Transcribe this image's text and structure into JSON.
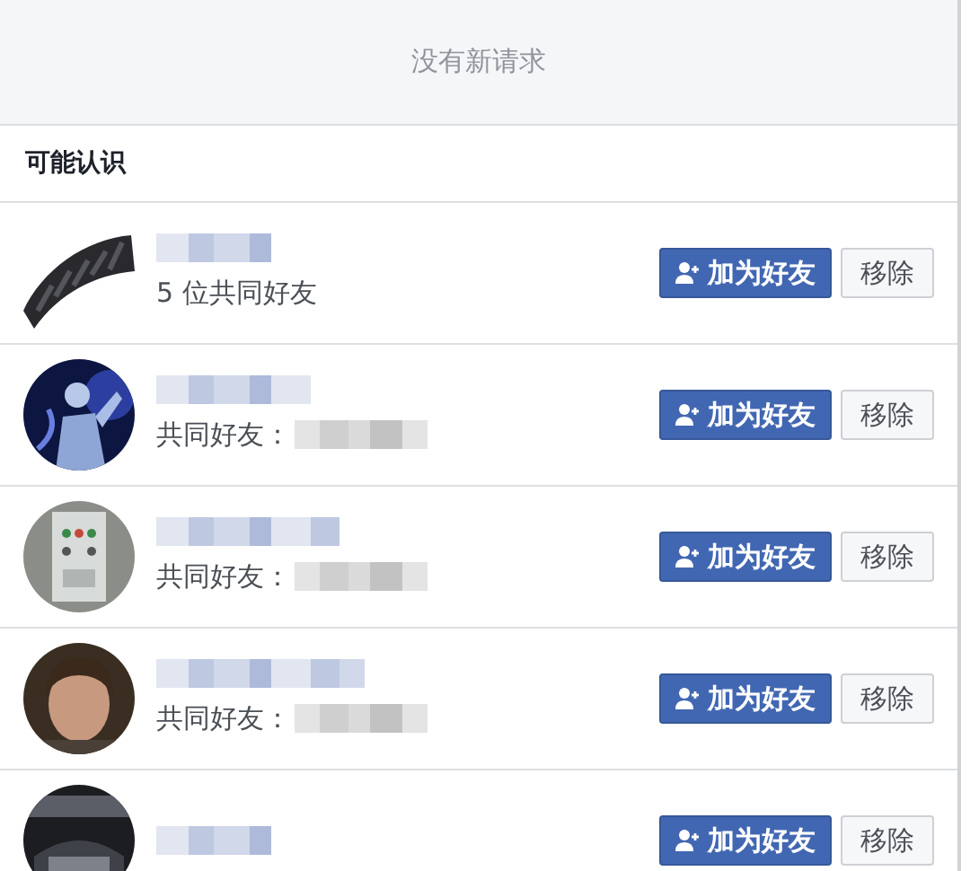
{
  "requests_notice": "没有新请求",
  "section_title": "可能认识",
  "people": [
    {
      "avatar_round": false,
      "name_redacted": true,
      "mutual_text": "5 位共同好友",
      "mutual_redacted": false,
      "add_label": "加为好友",
      "remove_label": "移除"
    },
    {
      "avatar_round": true,
      "name_redacted": true,
      "mutual_text": "共同好友：",
      "mutual_redacted": true,
      "add_label": "加为好友",
      "remove_label": "移除"
    },
    {
      "avatar_round": true,
      "name_redacted": true,
      "mutual_text": "共同好友：",
      "mutual_redacted": true,
      "add_label": "加为好友",
      "remove_label": "移除"
    },
    {
      "avatar_round": true,
      "name_redacted": true,
      "mutual_text": "共同好友：",
      "mutual_redacted": true,
      "add_label": "加为好友",
      "remove_label": "移除"
    },
    {
      "avatar_round": true,
      "name_redacted": true,
      "add_label": "加为好友",
      "remove_label": "移除"
    }
  ]
}
